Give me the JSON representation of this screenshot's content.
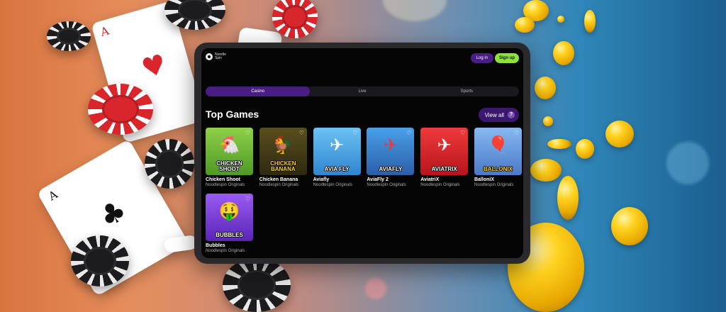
{
  "brand": {
    "logo_line1": "Noodle",
    "logo_line2": "Spin"
  },
  "header": {
    "login_label": "Log in",
    "signup_label": "Sign up"
  },
  "tabs": [
    {
      "label": "Casino",
      "active": true
    },
    {
      "label": "Live",
      "active": false
    },
    {
      "label": "Sports",
      "active": false
    }
  ],
  "section": {
    "title": "Top Games",
    "view_all_label": "View all",
    "help_glyph": "?"
  },
  "games": [
    {
      "name": "Chicken Shoot",
      "provider": "Noodlespin Originals",
      "thumb_label": "CHICKEN SHOOT",
      "icon": "chicken-icon",
      "bg": "#5aa82c"
    },
    {
      "name": "Chicken Banana",
      "provider": "Noodlespin Originals",
      "thumb_label": "CHICKEN BANANA",
      "icon": "chicken-banana-icon",
      "bg": "#3d3a1a"
    },
    {
      "name": "Aviafly",
      "provider": "Noodlespin Originals",
      "thumb_label": "AVIA FLY",
      "icon": "airplane-icon",
      "bg": "#3d8fd6"
    },
    {
      "name": "AviaFly 2",
      "provider": "Noodlespin Originals",
      "thumb_label": "AVIAFLY",
      "icon": "airplane-icon",
      "bg": "#2f6fb8"
    },
    {
      "name": "AviatriX",
      "provider": "Noodlespin Originals",
      "thumb_label": "AVIATRIX",
      "icon": "airplane-icon",
      "bg": "#d8232a"
    },
    {
      "name": "BalloniX",
      "provider": "Noodlespin Originals",
      "thumb_label": "BALLONIX",
      "icon": "balloon-icon",
      "bg": "#5b8fd8"
    },
    {
      "name": "Bubbles",
      "provider": "Noodlespin Originals",
      "thumb_label": "BUBBLES",
      "icon": "emoji-icon",
      "bg": "#7a3fd8"
    }
  ],
  "colors": {
    "accent_purple": "#4a1d86",
    "signup_green": "#8ce23a",
    "screen_bg": "#050505"
  }
}
